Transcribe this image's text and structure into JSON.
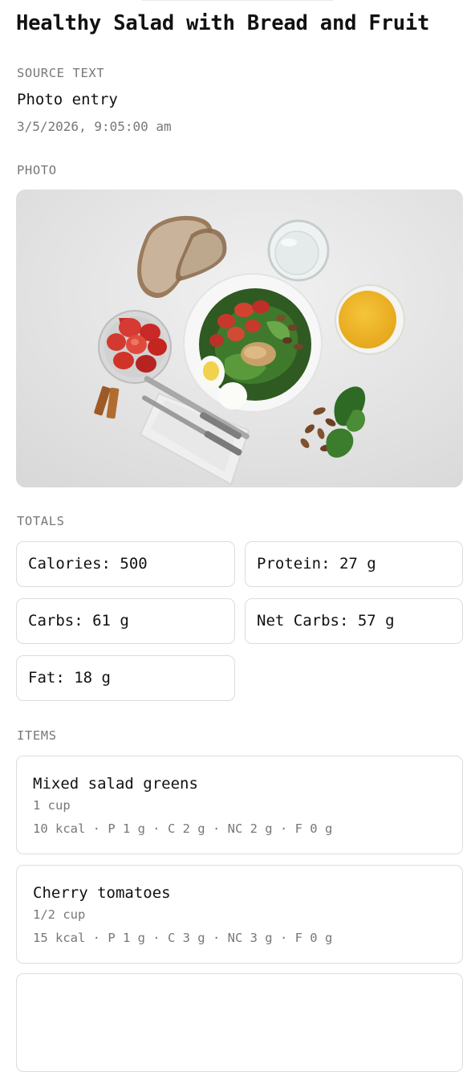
{
  "entry": {
    "title": "Healthy Salad with Bread and Fruit",
    "source_label": "SOURCE TEXT",
    "source_text": "Photo entry",
    "timestamp": "3/5/2026, 9:05:00 am",
    "photo_label": "PHOTO"
  },
  "totals": {
    "label": "TOTALS",
    "calories": "Calories: 500",
    "protein": "Protein: 27 g",
    "carbs": "Carbs: 61 g",
    "net_carbs": "Net Carbs: 57 g",
    "fat": "Fat: 18 g"
  },
  "items": {
    "label": "ITEMS",
    "list": [
      {
        "name": "Mixed salad greens",
        "quantity": "1 cup",
        "macros": "10 kcal · P 1 g · C 2 g · NC 2 g · F 0 g"
      },
      {
        "name": "Cherry tomatoes",
        "quantity": "1/2 cup",
        "macros": "15 kcal · P 1 g · C 3 g · NC 3 g · F 0 g"
      }
    ]
  },
  "colors": {
    "text_primary": "#111111",
    "text_muted": "#777777",
    "card_border": "#dcdcdc",
    "background": "#ffffff"
  }
}
